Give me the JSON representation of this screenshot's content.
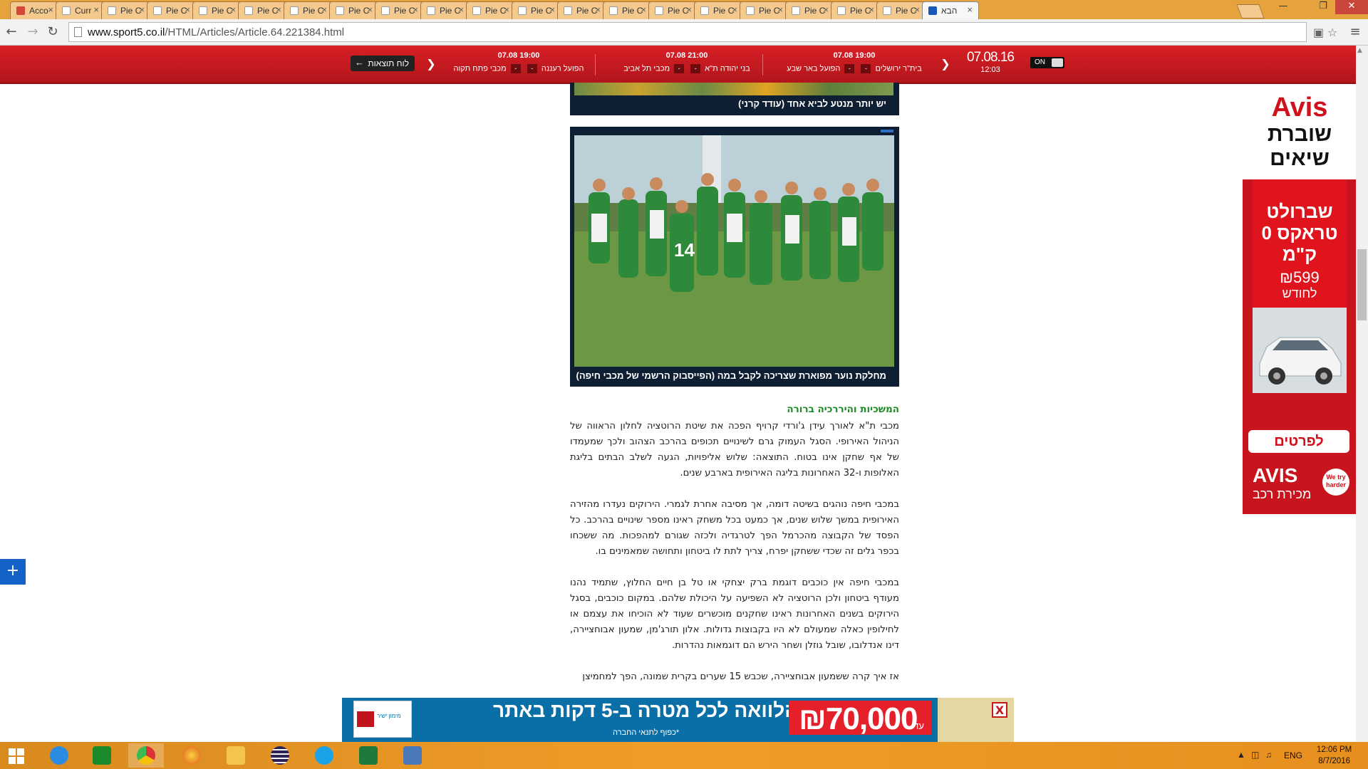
{
  "browser": {
    "tabs": [
      {
        "title": "Acco",
        "icon": "gmail-icon"
      },
      {
        "title": "Curr",
        "icon": "document-icon"
      },
      {
        "title": "Pie C",
        "icon": "document-icon"
      },
      {
        "title": "Pie C",
        "icon": "document-icon"
      },
      {
        "title": "Pie C",
        "icon": "document-icon"
      },
      {
        "title": "Pie C",
        "icon": "document-icon"
      },
      {
        "title": "Pie C",
        "icon": "document-icon"
      },
      {
        "title": "Pie C",
        "icon": "document-icon"
      },
      {
        "title": "Pie C",
        "icon": "document-icon"
      },
      {
        "title": "Pie C",
        "icon": "document-icon"
      },
      {
        "title": "Pie C",
        "icon": "document-icon"
      },
      {
        "title": "Pie C",
        "icon": "document-icon"
      },
      {
        "title": "Pie C",
        "icon": "document-icon"
      },
      {
        "title": "Pie C",
        "icon": "document-icon"
      },
      {
        "title": "Pie C",
        "icon": "document-icon"
      },
      {
        "title": "Pie C",
        "icon": "document-icon"
      },
      {
        "title": "Pie C",
        "icon": "document-icon"
      },
      {
        "title": "Pie C",
        "icon": "document-icon"
      },
      {
        "title": "Pie C",
        "icon": "document-icon"
      },
      {
        "title": "Pie C",
        "icon": "document-icon"
      },
      {
        "title": "הבא",
        "icon": "sport5-icon",
        "active": true
      }
    ],
    "url_host": "www.sport5.co.il",
    "url_path": "/HTML/Articles/Article.64.221384.html"
  },
  "scorebar": {
    "date": "07.08.16",
    "time": "12:03",
    "toggle_label": "ON",
    "results_button": "לוח תוצאות",
    "games": [
      {
        "time": "07.08 19:00",
        "home": "בית\"ר ירושלים",
        "away": "הפועל באר שבע",
        "home_score": "-",
        "away_score": "-"
      },
      {
        "time": "07.08 21:00",
        "home": "בני יהודה ת\"א",
        "away": "מכבי תל אביב",
        "home_score": "-",
        "away_score": "-"
      },
      {
        "time": "07.08 19:00",
        "home": "הפועל רעננה",
        "away": "מכבי פתח תקוה",
        "home_score": "-",
        "away_score": "-"
      }
    ]
  },
  "article": {
    "photo1_caption": "יש יותר מנטע לביא אחד (עודד קרני)",
    "photo2_caption": "מחלקת נוער מפוארת שצריכה לקבל במה (הפייסבוק הרשמי של מכבי חיפה)",
    "subheading": "המשכיות והיררכיה ברורה",
    "paragraphs": [
      "מכבי ת\"א לאורך עידן ג'ורדי קרויף הפכה את שיטת הרוטציה לחלון הראווה של הניהול האירופי. הסגל העמוק גרם לשינויים תכופים בהרכב הצהוב ולכך שמעמדו של אף שחקן אינו בטוח. התוצאה: שלוש אליפויות, הגעה לשלב הבתים בליגת האלופות ו-32 האחרונות בליגה האירופית בארבע שנים.",
      "במכבי חיפה נוהגים בשיטה דומה, אך מסיבה אחרת לגמרי. הירוקים נעדרו מהזירה האירופית במשך שלוש שנים, אך כמעט בכל משחק ראינו מספר שינויים בהרכב. כל הפסד של הקבוצה מהכרמל הפך לטרגדיה ולכזה שגורם למהפכות. מה ששכחו בכפר גלים זה שכדי ששחקן יפרח, צריך לתת לו ביטחון ותחושה שמאמינים בו.",
      "במכבי חיפה אין כוכבים דוגמת ברק יצחקי או טל בן חיים החלוץ, שתמיד נהנו מעודף ביטחון ולכן הרוטציה לא השפיעה על היכולת שלהם. במקום כוכבים, בסגל הירוקים בשנים האחרונות ראינו שחקנים מוכשרים שעוד לא הוכיחו את עצמם או לחילופין כאלה שמעולם לא היו בקבוצות גדולות. אלון תורג'מן, שמעון אבוחציירה, דינו אנדלובו, שובל גוזלן ושחר הירש הם דוגמאות נהדרות.",
      "אז איך קרה ששמעון אבוחציירה, שכבש 15 שערים בקרית שמונה, הפך למחמיצן"
    ]
  },
  "side_ad": {
    "brand": "Avis",
    "tagline": "שוברת שיאים",
    "product": "שברולט טראקס 0 ק\"מ",
    "price": "₪599",
    "per": "לחודש",
    "cta": "לפרטים",
    "brand2": "AVIS",
    "rental": "מכירת רכב",
    "badge": "We try harder"
  },
  "bottom_ad": {
    "amount": "₪70,000",
    "upto": "עד",
    "headline": "הלוואה לכל מטרה ב-5 דקות באתר",
    "terms": "*כפוף לתנאי החברה",
    "logo_text": "מימון ישיר",
    "close": "X"
  },
  "plus_button": "+",
  "taskbar": {
    "language": "ENG",
    "time": "12:06 PM",
    "date": "8/7/2016",
    "items": [
      "internet-explorer-icon",
      "store-icon",
      "chrome-icon",
      "firefox-icon",
      "file-explorer-icon",
      "eclipse-icon",
      "skype-icon",
      "excel-icon",
      "remote-desktop-icon"
    ]
  },
  "colors": {
    "scorebar": "#c81a20",
    "subheading": "#1c8a25",
    "taskbar": "#e8931f",
    "ad_red": "#c8141c",
    "banner_blue": "#0a6fa6"
  }
}
